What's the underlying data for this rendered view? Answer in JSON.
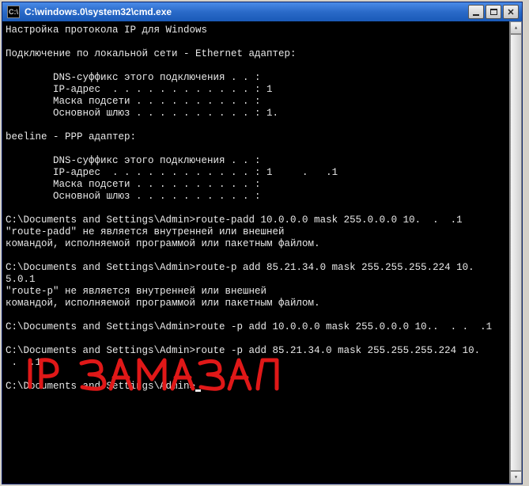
{
  "window": {
    "title": "C:\\windows.0\\system32\\cmd.exe",
    "icon_label": "C:\\"
  },
  "terminal": {
    "lines": [
      "Настройка протокола IP для Windows",
      "",
      "Подключение по локальной сети - Ethernet адаптер:",
      "",
      "        DNS-суффикс этого подключения . . :",
      "        IP-адрес  . . . . . . . . . . . . : 1",
      "        Маска подсети . . . . . . . . . . :",
      "        Основной шлюз . . . . . . . . . . : 1.",
      "",
      "beeline - PPP адаптер:",
      "",
      "        DNS-суффикс этого подключения . . :",
      "        IP-адрес  . . . . . . . . . . . . : 1     .   .1",
      "        Маска подсети . . . . . . . . . . :",
      "        Основной шлюз . . . . . . . . . . :",
      "",
      "C:\\Documents and Settings\\Admin>route-padd 10.0.0.0 mask 255.0.0.0 10.  .  .1",
      "\"route-padd\" не является внутренней или внешней",
      "командой, исполняемой программой или пакетным файлом.",
      "",
      "C:\\Documents and Settings\\Admin>route-p add 85.21.34.0 mask 255.255.255.224 10.",
      "5.0.1",
      "\"route-p\" не является внутренней или внешней",
      "командой, исполняемой программой или пакетным файлом.",
      "",
      "C:\\Documents and Settings\\Admin>route -p add 10.0.0.0 mask 255.0.0.0 10..  . .  .1",
      "",
      "C:\\Documents and Settings\\Admin>route -p add 85.21.34.0 mask 255.255.255.224 10.",
      " .  .1",
      ""
    ],
    "prompt": "C:\\Documents and Settings\\Admin>"
  },
  "annotation": {
    "text": "IP ЗАМАЗАЛ"
  }
}
